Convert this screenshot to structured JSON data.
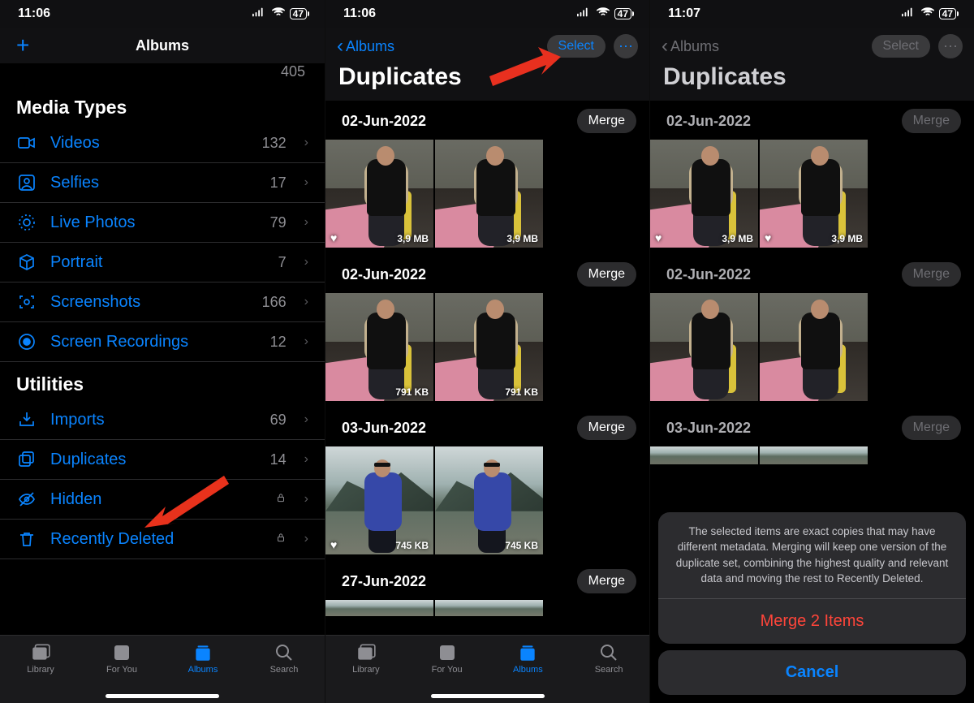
{
  "status": {
    "time1": "11:06",
    "time2": "11:06",
    "time3": "11:07",
    "battery": "47"
  },
  "panel1": {
    "title": "Albums",
    "stray_left": "",
    "stray_right": "405",
    "media_types_title": "Media Types",
    "media_types": [
      {
        "label": "Videos",
        "count": "132"
      },
      {
        "label": "Selfies",
        "count": "17"
      },
      {
        "label": "Live Photos",
        "count": "79"
      },
      {
        "label": "Portrait",
        "count": "7"
      },
      {
        "label": "Screenshots",
        "count": "166"
      },
      {
        "label": "Screen Recordings",
        "count": "12"
      }
    ],
    "utilities_title": "Utilities",
    "utilities": [
      {
        "label": "Imports",
        "count": "69",
        "locked": false
      },
      {
        "label": "Duplicates",
        "count": "14",
        "locked": false
      },
      {
        "label": "Hidden",
        "count": "",
        "locked": true
      },
      {
        "label": "Recently Deleted",
        "count": "",
        "locked": true
      }
    ]
  },
  "tabs": {
    "library": "Library",
    "foryou": "For You",
    "albums": "Albums",
    "search": "Search"
  },
  "panel2": {
    "back": "Albums",
    "title": "Duplicates",
    "select": "Select",
    "groups": [
      {
        "date": "02-Jun-2022",
        "merge": "Merge",
        "size1": "3,9 MB",
        "size2": "3,9 MB",
        "heart1": true,
        "scene": 1
      },
      {
        "date": "02-Jun-2022",
        "merge": "Merge",
        "size1": "791 KB",
        "size2": "791 KB",
        "heart1": false,
        "scene": 1
      },
      {
        "date": "03-Jun-2022",
        "merge": "Merge",
        "size1": "745 KB",
        "size2": "745 KB",
        "heart1": true,
        "scene": 2
      },
      {
        "date": "27-Jun-2022",
        "merge": "Merge",
        "size1": "",
        "size2": "",
        "heart1": false,
        "scene": 2
      }
    ]
  },
  "panel3": {
    "back": "Albums",
    "title": "Duplicates",
    "select": "Select",
    "groups": [
      {
        "date": "02-Jun-2022",
        "merge": "Merge",
        "size1": "3,9 MB",
        "size2": "3,9 MB",
        "heart1": true,
        "scene": 1
      },
      {
        "date": "02-Jun-2022",
        "merge": "Merge",
        "size1": "",
        "size2": "",
        "heart1": false,
        "scene": 1
      },
      {
        "date": "03-Jun-2022",
        "merge": "Merge",
        "size1": "",
        "size2": "",
        "heart1": false,
        "scene": 2
      }
    ],
    "sheet": {
      "msg": "The selected items are exact copies that may have different metadata. Merging will keep one version of the duplicate set, combining the highest quality and relevant data and moving the rest to Recently Deleted.",
      "action": "Merge 2 Items",
      "cancel": "Cancel"
    }
  }
}
